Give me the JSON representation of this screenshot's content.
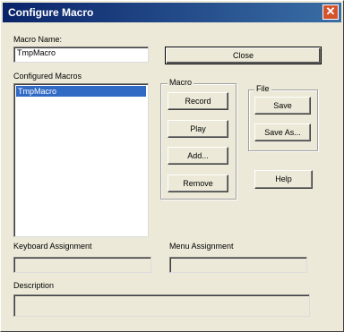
{
  "window": {
    "title": "Configure Macro",
    "close_glyph": "✕"
  },
  "macro_name": {
    "label": "Macro Name:",
    "value": "TmpMacro"
  },
  "close_button": {
    "label": "Close"
  },
  "configured_macros": {
    "label": "Configured Macros",
    "items": [
      "TmpMacro"
    ],
    "selected_index": 0
  },
  "macro_group": {
    "title": "Macro",
    "record": "Record",
    "play": "Play",
    "add": "Add...",
    "remove": "Remove"
  },
  "file_group": {
    "title": "File",
    "save": "Save",
    "save_as": "Save As..."
  },
  "help_button": {
    "label": "Help"
  },
  "keyboard_assignment": {
    "label": "Keyboard Assignment",
    "value": ""
  },
  "menu_assignment": {
    "label": "Menu Assignment",
    "value": ""
  },
  "description": {
    "label": "Description",
    "value": ""
  },
  "colors": {
    "title_start": "#0a246a",
    "title_end": "#3a6ea5",
    "selection": "#316ac5",
    "face": "#ece9d8"
  }
}
